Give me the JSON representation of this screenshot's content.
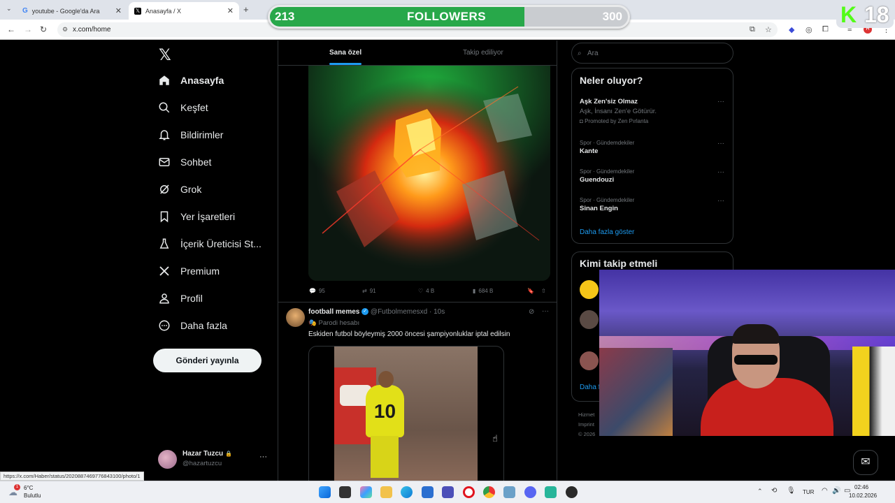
{
  "browser": {
    "tabs": [
      {
        "title": "youtube - Google'da Ara",
        "active": false
      },
      {
        "title": "Anasayfa / X",
        "active": true
      }
    ],
    "url": "x.com/home",
    "status_url": "https://x.com/Haber/status/2020887469776843100/photo/1"
  },
  "overlay": {
    "followers_current": "213",
    "followers_label": "FOLLOWERS",
    "followers_goal": "300",
    "followers_fraction": 0.71,
    "badge_letter": "K",
    "badge_number": "18"
  },
  "nav": {
    "items": [
      {
        "label": "Anasayfa",
        "icon": "home-icon",
        "active": true
      },
      {
        "label": "Keşfet",
        "icon": "search-icon",
        "active": false
      },
      {
        "label": "Bildirimler",
        "icon": "bell-icon",
        "active": false
      },
      {
        "label": "Sohbet",
        "icon": "mail-icon",
        "active": false
      },
      {
        "label": "Grok",
        "icon": "grok-icon",
        "active": false
      },
      {
        "label": "Yer İşaretleri",
        "icon": "bookmark-icon",
        "active": false
      },
      {
        "label": "İçerik Üreticisi St...",
        "icon": "flask-icon",
        "active": false
      },
      {
        "label": "Premium",
        "icon": "x-logo-icon",
        "active": false
      },
      {
        "label": "Profil",
        "icon": "person-icon",
        "active": false
      },
      {
        "label": "Daha fazla",
        "icon": "more-circle-icon",
        "active": false
      }
    ],
    "post_button": "Gönderi yayınla",
    "profile_name": "Hazar Tuzcu",
    "profile_handle": "@hazartuzcu",
    "profile_more": "···"
  },
  "feed": {
    "tabs": [
      "Sana özel",
      "Takip ediliyor"
    ],
    "tweet1_actions": {
      "replies": "95",
      "retweets": "91",
      "likes": "4 B",
      "views": "684 B"
    },
    "tweet2": {
      "name": "football memes",
      "handle": "@Futbolmemesxd",
      "time": "· 10s",
      "badge": "Parodi hesabı",
      "text": "Eskiden futbol böyleymiş 2000 öncesi şampiyonluklar iptal edilsin",
      "more": "···"
    },
    "jersey_number": "10"
  },
  "sidebar": {
    "search_placeholder": "Ara",
    "trends_title": "Neler oluyor?",
    "promoted": {
      "title": "Aşk Zen'siz Olmaz",
      "subtitle": "Aşk, İnsanı Zen'e Götürür.",
      "promoted_by": "Promoted by Zen Pırlanta"
    },
    "trends": [
      {
        "context": "Spor · Gündemdekiler",
        "name": "Kante"
      },
      {
        "context": "Spor · Gündemdekiler",
        "name": "Guendouzi"
      },
      {
        "context": "Spor · Gündemdekiler",
        "name": "Sinan Engin"
      }
    ],
    "show_more": "Daha fazla göster",
    "who_to_follow_title": "Kimi takip etmeli",
    "who_to_follow_show_more": "Daha f",
    "footer_lines": [
      "Hizmet",
      "Imprint",
      "© 2026"
    ]
  },
  "taskbar": {
    "weather_temp": "6°C",
    "weather_desc": "Bulutlu",
    "language": "TUR",
    "time": "02:46",
    "date": "10.02.2026"
  }
}
